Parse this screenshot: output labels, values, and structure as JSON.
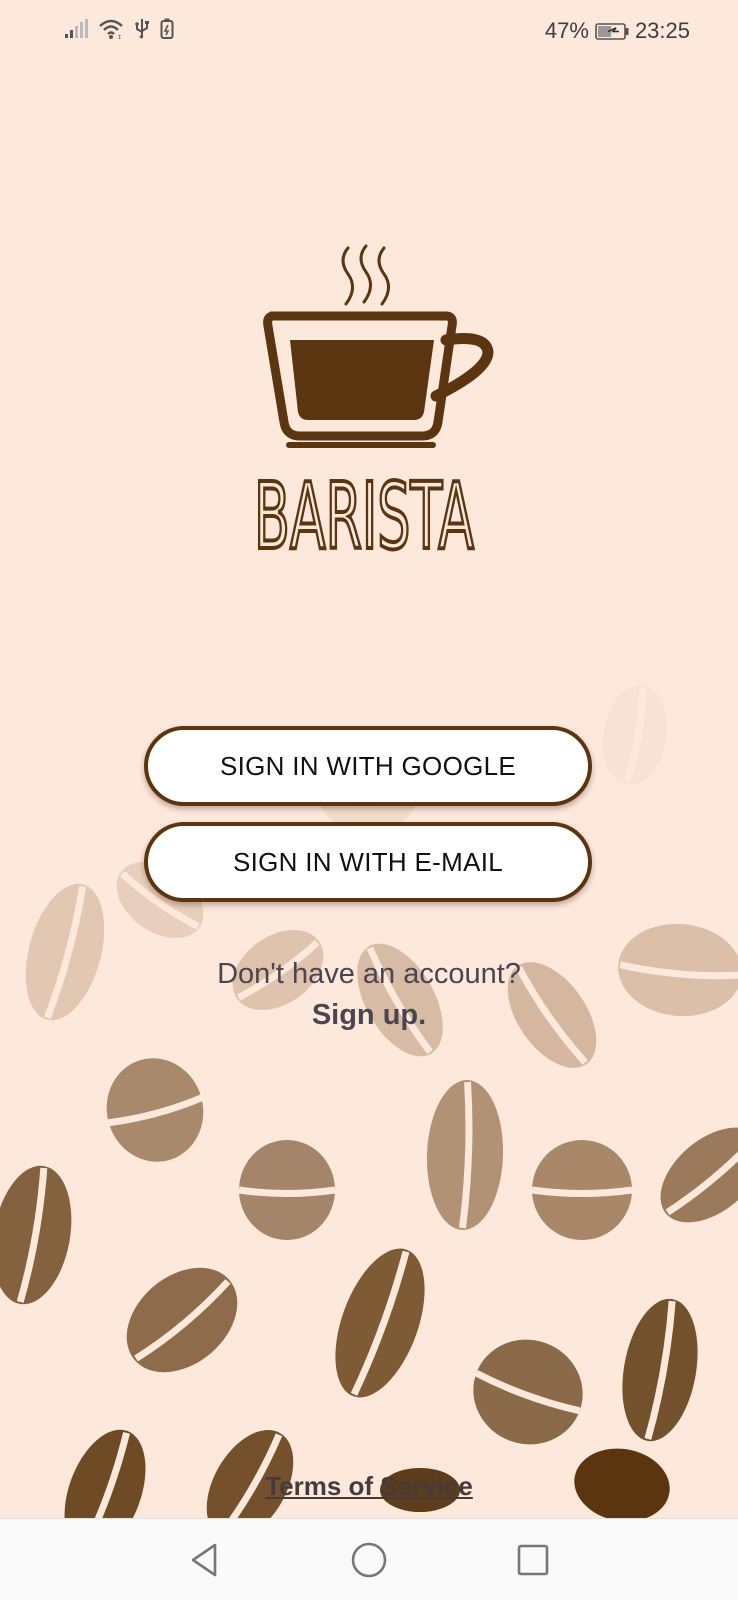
{
  "status_bar": {
    "battery_percent": "47%",
    "time": "23:25",
    "icons": [
      "signal-icon",
      "wifi-icon",
      "usb-icon",
      "battery-saver-icon",
      "battery-charging-icon"
    ]
  },
  "logo": {
    "brand_text": "BARISTA",
    "color": "#5a3510"
  },
  "auth": {
    "google_button": "SIGN IN WITH GOOGLE",
    "email_button": "SIGN IN WITH E-MAIL",
    "no_account_text": "Don't have an account?",
    "signup_link": "Sign up.",
    "terms_link": "Terms of Service"
  },
  "nav": {
    "icons": [
      "back-icon",
      "home-icon",
      "recent-apps-icon"
    ]
  },
  "colors": {
    "background": "#fde8dc",
    "brand_brown": "#5a3510",
    "button_bg": "#ffffff"
  }
}
